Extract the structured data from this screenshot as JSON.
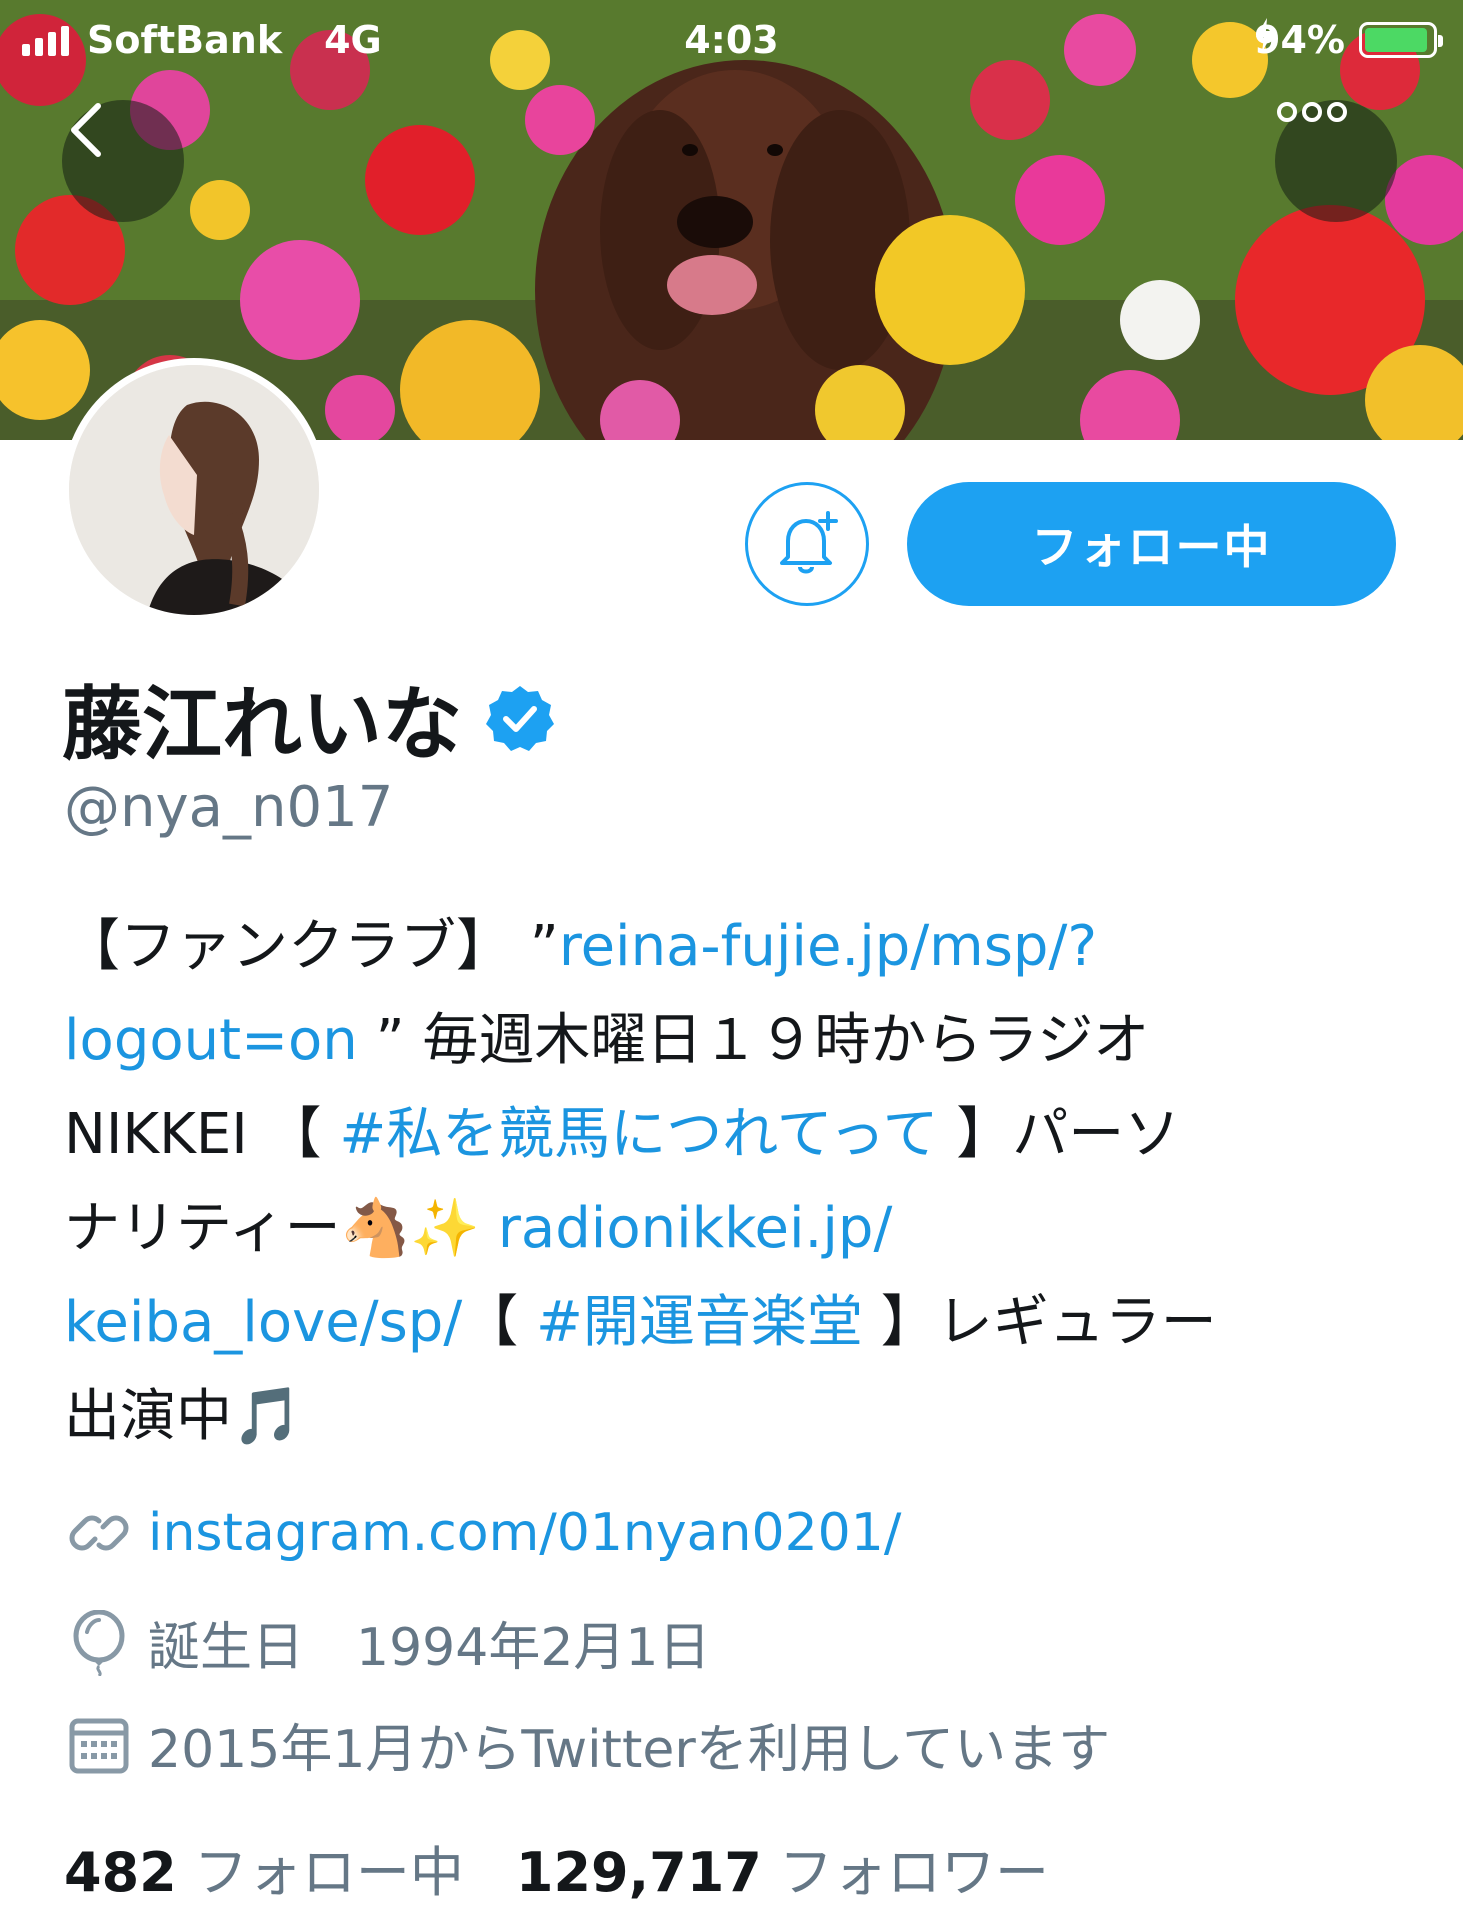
{
  "status_bar": {
    "carrier": "SoftBank",
    "network": "4G",
    "time": "4:03",
    "battery": "94%",
    "battery_level": 0.94
  },
  "header": {
    "back_icon": "chevron-left-icon",
    "more_icon": "more-dots-icon"
  },
  "actions": {
    "notify_icon": "bell-plus-icon",
    "follow_label": "フォロー中"
  },
  "profile": {
    "display_name": "藤江れいな",
    "verified": true,
    "handle": "@nya_n017",
    "bio_lines": [
      {
        "parts": [
          {
            "t": "【ファンクラブ】 ”",
            "link": false
          },
          {
            "t": "reina-fujie.jp/msp/?",
            "link": true
          }
        ]
      },
      {
        "parts": [
          {
            "t": "logout=on",
            "link": true
          },
          {
            "t": " ” 毎週木曜日１９時からラジオ",
            "link": false
          }
        ]
      },
      {
        "parts": [
          {
            "t": "NIKKEI 【 ",
            "link": false
          },
          {
            "t": "#私を競馬につれてって",
            "link": true
          },
          {
            "t": " 】パーソ",
            "link": false
          }
        ]
      },
      {
        "parts": [
          {
            "t": "ナリティー🐴✨ ",
            "link": false
          },
          {
            "t": "radionikkei.jp/",
            "link": true
          }
        ]
      },
      {
        "parts": [
          {
            "t": "keiba_love/sp/",
            "link": true
          },
          {
            "t": "【 ",
            "link": false
          },
          {
            "t": "#開運音楽堂",
            "link": true
          },
          {
            "t": " 】レギュラー",
            "link": false
          }
        ]
      },
      {
        "parts": [
          {
            "t": "出演中🎵",
            "link": false
          }
        ]
      }
    ],
    "website": "instagram.com/01nyan0201/",
    "birthday": "誕生日　1994年2月1日",
    "joined": "2015年1月からTwitterを利用しています",
    "following_count": "482",
    "following_label": "フォロー中",
    "followers_count": "129,717",
    "followers_label": "フォロワー"
  },
  "colors": {
    "accent": "#1da1f2",
    "link": "#1b95e0",
    "secondary_text": "#657786",
    "primary_text": "#14171a"
  }
}
